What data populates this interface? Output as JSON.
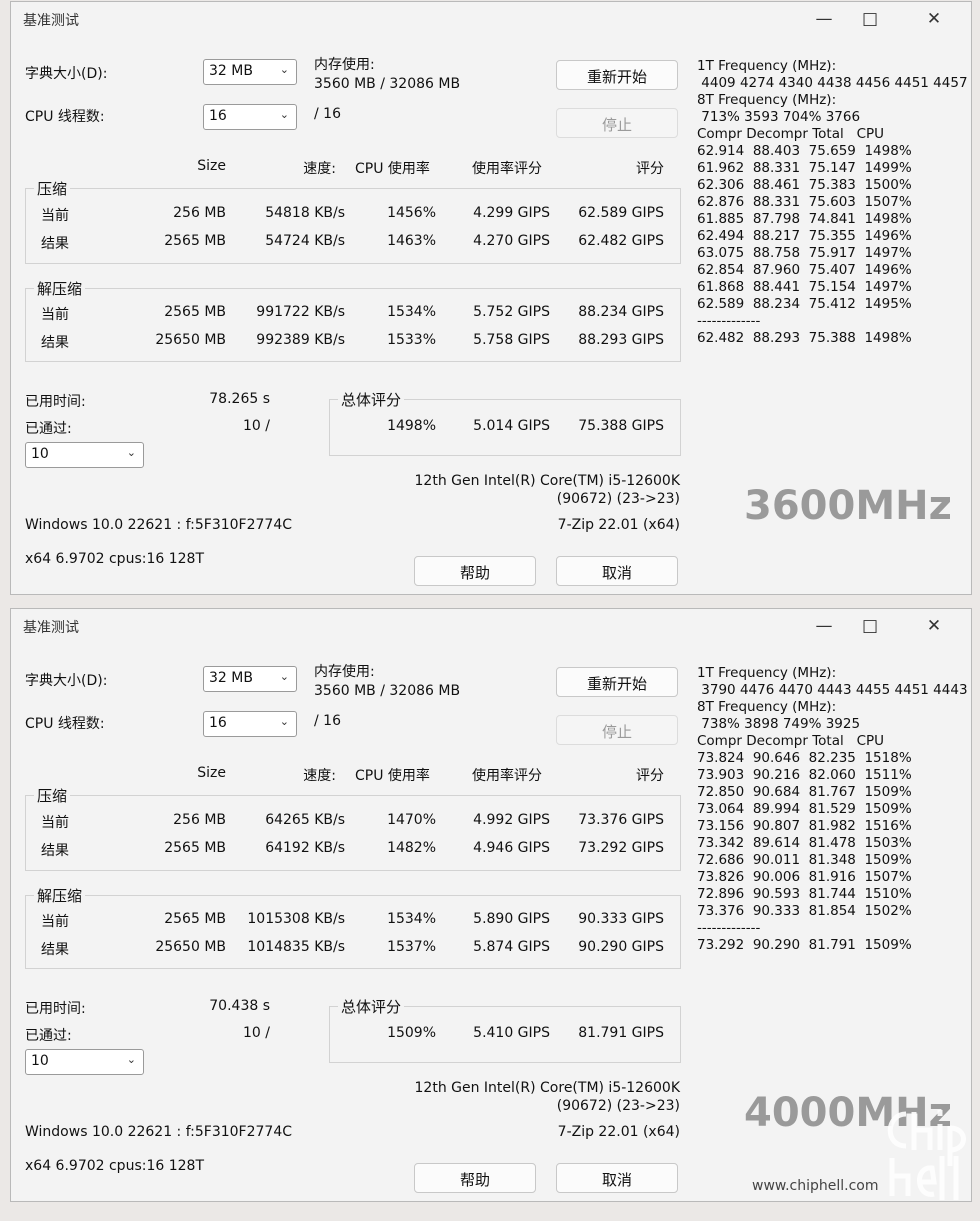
{
  "windows": [
    {
      "title": "基准测试",
      "dict_label": "字典大小(D):",
      "dict_value": "32 MB",
      "threads_label": "CPU 线程数:",
      "threads_value": "16",
      "threads_max": "/ 16",
      "mem_label": "内存使用:",
      "mem_value": "3560 MB / 32086 MB",
      "restart_label": "重新开始",
      "stop_label": "停止",
      "headers": {
        "size": "Size",
        "speed": "速度:",
        "cpu": "CPU 使用率",
        "rating_usage": "使用率评分",
        "rating": "评分"
      },
      "compress": {
        "label": "压缩",
        "current": {
          "label": "当前",
          "size": "256 MB",
          "speed": "54818 KB/s",
          "cpu": "1456%",
          "usage": "4.299 GIPS",
          "rating": "62.589 GIPS"
        },
        "result": {
          "label": "结果",
          "size": "2565 MB",
          "speed": "54724 KB/s",
          "cpu": "1463%",
          "usage": "4.270 GIPS",
          "rating": "62.482 GIPS"
        }
      },
      "decompress": {
        "label": "解压缩",
        "current": {
          "label": "当前",
          "size": "2565 MB",
          "speed": "991722 KB/s",
          "cpu": "1534%",
          "usage": "5.752 GIPS",
          "rating": "88.234 GIPS"
        },
        "result": {
          "label": "结果",
          "size": "25650 MB",
          "speed": "992389 KB/s",
          "cpu": "1533%",
          "usage": "5.758 GIPS",
          "rating": "88.293 GIPS"
        }
      },
      "elapsed_label": "已用时间:",
      "elapsed_value": "78.265 s",
      "passed_label": "已通过:",
      "passed_value": "10 /",
      "passes_select": "10",
      "total": {
        "label": "总体评分",
        "cpu": "1498%",
        "usage": "5.014 GIPS",
        "rating": "75.388 GIPS"
      },
      "cpu_name": "12th Gen Intel(R) Core(TM) i5-12600K",
      "cpu_id": "(90672) (23->23)",
      "os": "Windows 10.0 22621 : f:5F310F2774C",
      "version": "7-Zip 22.01 (x64)",
      "sysinfo": "x64 6.9702 cpus:16 128T",
      "help_label": "帮助",
      "cancel_label": "取消",
      "stats": {
        "freq1_label": "1T Frequency (MHz):",
        "freq1_values": " 4409 4274 4340 4438 4456 4451 4457",
        "freq8_label": "8T Frequency (MHz):",
        "freq8_values": " 713% 3593 704% 3766",
        "table_header": "Compr Decompr Total   CPU",
        "rows": [
          "62.914  88.403  75.659  1498%",
          "61.962  88.331  75.147  1499%",
          "62.306  88.461  75.383  1500%",
          "62.876  88.331  75.603  1507%",
          "61.885  87.798  74.841  1498%",
          "62.494  88.217  75.355  1496%",
          "63.075  88.758  75.917  1497%",
          "62.854  87.960  75.407  1496%",
          "61.868  88.441  75.154  1497%",
          "62.589  88.234  75.412  1495%"
        ],
        "separator": "-------------",
        "summary": "62.482  88.293  75.388  1498%"
      },
      "watermark": "3600MHz"
    },
    {
      "title": "基准测试",
      "dict_label": "字典大小(D):",
      "dict_value": "32 MB",
      "threads_label": "CPU 线程数:",
      "threads_value": "16",
      "threads_max": "/ 16",
      "mem_label": "内存使用:",
      "mem_value": "3560 MB / 32086 MB",
      "restart_label": "重新开始",
      "stop_label": "停止",
      "headers": {
        "size": "Size",
        "speed": "速度:",
        "cpu": "CPU 使用率",
        "rating_usage": "使用率评分",
        "rating": "评分"
      },
      "compress": {
        "label": "压缩",
        "current": {
          "label": "当前",
          "size": "256 MB",
          "speed": "64265 KB/s",
          "cpu": "1470%",
          "usage": "4.992 GIPS",
          "rating": "73.376 GIPS"
        },
        "result": {
          "label": "结果",
          "size": "2565 MB",
          "speed": "64192 KB/s",
          "cpu": "1482%",
          "usage": "4.946 GIPS",
          "rating": "73.292 GIPS"
        }
      },
      "decompress": {
        "label": "解压缩",
        "current": {
          "label": "当前",
          "size": "2565 MB",
          "speed": "1015308 KB/s",
          "cpu": "1534%",
          "usage": "5.890 GIPS",
          "rating": "90.333 GIPS"
        },
        "result": {
          "label": "结果",
          "size": "25650 MB",
          "speed": "1014835 KB/s",
          "cpu": "1537%",
          "usage": "5.874 GIPS",
          "rating": "90.290 GIPS"
        }
      },
      "elapsed_label": "已用时间:",
      "elapsed_value": "70.438 s",
      "passed_label": "已通过:",
      "passed_value": "10 /",
      "passes_select": "10",
      "total": {
        "label": "总体评分",
        "cpu": "1509%",
        "usage": "5.410 GIPS",
        "rating": "81.791 GIPS"
      },
      "cpu_name": "12th Gen Intel(R) Core(TM) i5-12600K",
      "cpu_id": "(90672) (23->23)",
      "os": "Windows 10.0 22621 : f:5F310F2774C",
      "version": "7-Zip 22.01 (x64)",
      "sysinfo": "x64 6.9702 cpus:16 128T",
      "help_label": "帮助",
      "cancel_label": "取消",
      "stats": {
        "freq1_label": "1T Frequency (MHz):",
        "freq1_values": " 3790 4476 4470 4443 4455 4451 4443",
        "freq8_label": "8T Frequency (MHz):",
        "freq8_values": " 738% 3898 749% 3925",
        "table_header": "Compr Decompr Total   CPU",
        "rows": [
          "73.824  90.646  82.235  1518%",
          "73.903  90.216  82.060  1511%",
          "72.850  90.684  81.767  1509%",
          "73.064  89.994  81.529  1509%",
          "73.156  90.807  81.982  1516%",
          "73.342  89.614  81.478  1503%",
          "72.686  90.011  81.348  1509%",
          "73.826  90.006  81.916  1507%",
          "72.896  90.593  81.744  1510%",
          "73.376  90.333  81.854  1502%"
        ],
        "separator": "-------------",
        "summary": "73.292  90.290  81.791  1509%"
      },
      "watermark": "4000MHz"
    }
  ],
  "site": {
    "logo_text": "chiphell",
    "url": "www.chiphell.com"
  },
  "icons": {
    "minimize": "minimize-icon",
    "maximize": "maximize-icon",
    "close": "close-icon",
    "dropdown": "chevron-down-icon"
  }
}
